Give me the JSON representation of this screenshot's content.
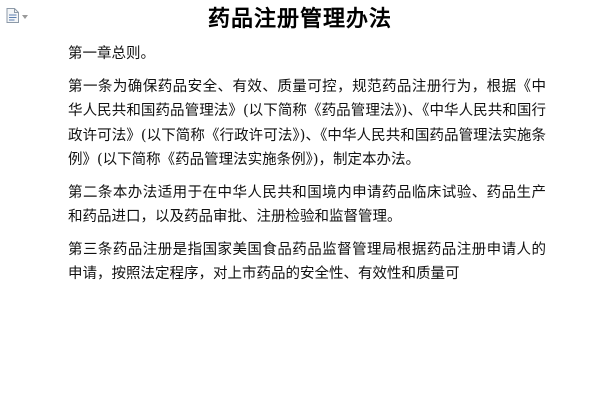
{
  "document": {
    "icon": "document-icon",
    "title": "药品注册管理办法",
    "paragraphs": [
      "第一章总则。",
      "第一条为确保药品安全、有效、质量可控，规范药品注册行为，根据《中华人民共和国药品管理法》(以下简称《药品管理法》)、《中华人民共和国行政许可法》(以下简称《行政许可法》)、《中华人民共和国药品管理法实施条例》(以下简称《药品管理法实施条例》)，制定本办法。",
      "第二条本办法适用于在中华人民共和国境内申请药品临床试验、药品生产和药品进口，以及药品审批、注册检验和监督管理。",
      "第三条药品注册是指国家美国食品药品监督管理局根据药品注册申请人的申请，按照法定程序，对上市药品的安全性、有效性和质量可"
    ]
  }
}
